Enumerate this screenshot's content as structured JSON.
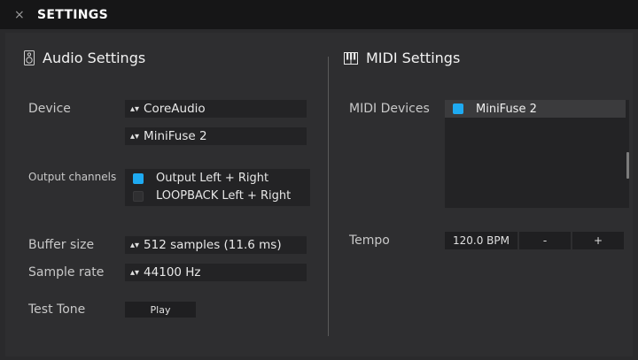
{
  "window": {
    "title": "SETTINGS",
    "close_symbol": "×"
  },
  "audio": {
    "heading": "Audio Settings",
    "device_label": "Device",
    "device_value": "CoreAudio",
    "device2_value": "MiniFuse 2",
    "output_channels_label": "Output channels",
    "channels": [
      {
        "label": "Output Left + Right",
        "checked": true
      },
      {
        "label": "LOOPBACK Left + Right",
        "checked": false
      }
    ],
    "buffer_label": "Buffer size",
    "buffer_value": "512 samples (11.6 ms)",
    "sample_rate_label": "Sample rate",
    "sample_rate_value": "44100 Hz",
    "test_tone_label": "Test Tone",
    "play_label": "Play"
  },
  "midi": {
    "heading": "MIDI Settings",
    "devices_label": "MIDI Devices",
    "devices": [
      {
        "label": "MiniFuse 2",
        "checked": true
      }
    ],
    "tempo_label": "Tempo",
    "tempo_value": "120.0 BPM",
    "minus_label": "-",
    "plus_label": "+"
  },
  "icons": {
    "close": "close-icon",
    "speaker": "speaker-icon",
    "piano": "piano-keys-icon",
    "dropdown": "dropdown-arrows-icon"
  },
  "colors": {
    "accent": "#1eaaf1",
    "titlebar": "#161617",
    "panel": "#2e2e30"
  }
}
